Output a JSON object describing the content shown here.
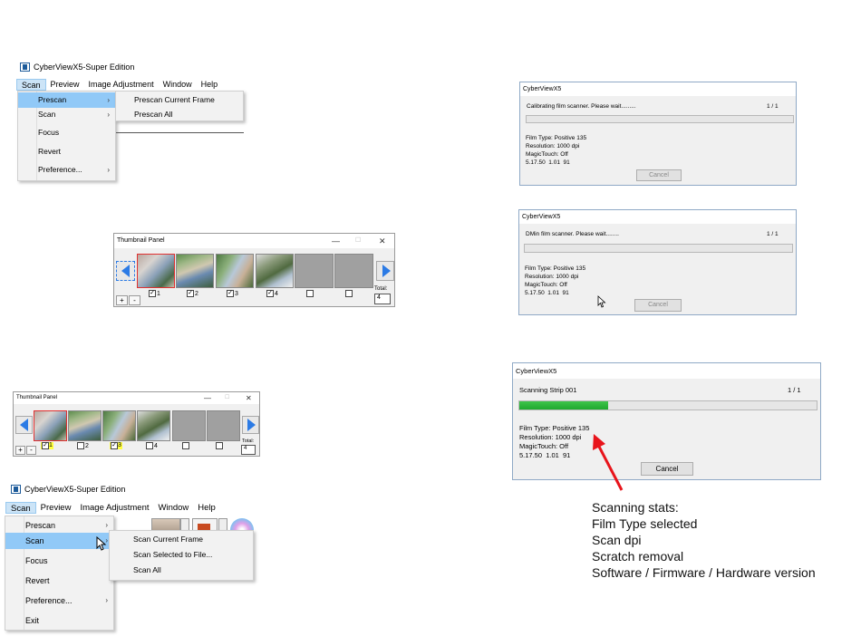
{
  "app_title": "CyberViewX5-Super Edition",
  "menubar": [
    "Scan",
    "Preview",
    "Image Adjustment",
    "Window",
    "Help"
  ],
  "menu1": {
    "items": [
      "Prescan",
      "Scan",
      "Focus",
      "Revert",
      "Preference..."
    ],
    "submenu": [
      "Prescan Current Frame",
      "Prescan All"
    ]
  },
  "menu2": {
    "items": [
      "Prescan",
      "Scan",
      "Focus",
      "Revert",
      "Preference...",
      "Exit"
    ],
    "submenu": [
      "Scan Current Frame",
      "Scan Selected to File...",
      "Scan All"
    ]
  },
  "thumb_panel": {
    "title": "Thumbnail Panel",
    "min": "—",
    "max": "☐",
    "close": "✕",
    "labels": [
      "1",
      "2",
      "3",
      "4",
      "",
      ""
    ],
    "plus": "+",
    "minus": "-",
    "total_label": "Total:",
    "total_value": "4"
  },
  "dialogs": [
    {
      "title": "CyberViewX5",
      "message": "Calibrating film scanner. Please wait.........",
      "count": "1 / 1",
      "info": "Film Type: Positive 135\nResolution: 1000 dpi\nMagicTouch: Off\n5.17.50  1.01  91",
      "progress": 0,
      "cancel": "Cancel"
    },
    {
      "title": "CyberViewX5",
      "message": "DMin film scanner. Please wait........",
      "count": "1 / 1",
      "info": "Film Type: Positive 135\nResolution: 1000 dpi\nMagicTouch: Off\n5.17.50  1.01  91",
      "progress": 0,
      "cancel": "Cancel"
    },
    {
      "title": "CyberViewX5",
      "message": "Scanning Strip 001",
      "count": "1 / 1",
      "info": "Film Type: Positive 135\nResolution: 1000 dpi\nMagicTouch: Off\n5.17.50  1.01  91",
      "progress": 0.3,
      "cancel": "Cancel"
    }
  ],
  "annotation": {
    "heading": "Scanning stats:",
    "lines": [
      "Film Type selected",
      "Scan dpi",
      "Scratch removal",
      "Software / Firmware / Hardware version"
    ],
    "arrow_color": "#e8141b"
  }
}
